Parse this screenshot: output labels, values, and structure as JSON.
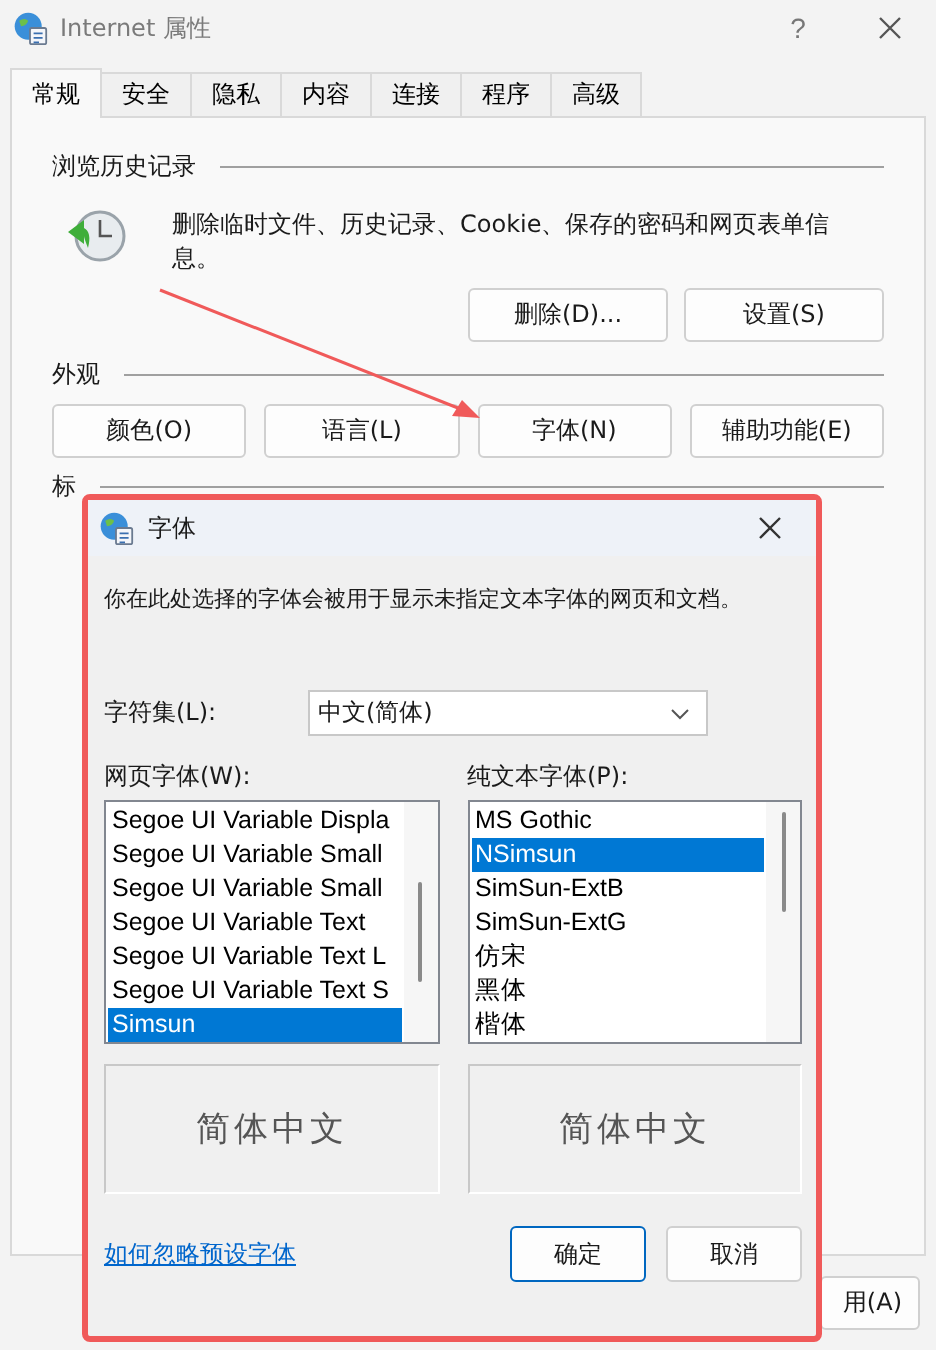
{
  "window": {
    "title": "Internet 属性",
    "help": "?"
  },
  "tabs": [
    {
      "label": "常规",
      "selected": true
    },
    {
      "label": "安全",
      "selected": false
    },
    {
      "label": "隐私",
      "selected": false
    },
    {
      "label": "内容",
      "selected": false
    },
    {
      "label": "连接",
      "selected": false
    },
    {
      "label": "程序",
      "selected": false
    },
    {
      "label": "高级",
      "selected": false
    }
  ],
  "browsing_history": {
    "heading": "浏览历史记录",
    "description": "删除临时文件、历史记录、Cookie、保存的密码和网页表单信息。",
    "buttons": [
      "删除(D)...",
      "设置(S)"
    ]
  },
  "appearance": {
    "heading": "外观",
    "buttons": [
      "颜色(O)",
      "语言(L)",
      "字体(N)",
      "辅助功能(E)"
    ]
  },
  "tabs_section": {
    "heading": "标"
  },
  "footer_buttons": [
    "用(A)"
  ],
  "font_dialog": {
    "title": "字体",
    "description": "你在此处选择的字体会被用于显示未指定文本字体的网页和文档。",
    "charset": {
      "label": "字符集(L):",
      "value": "中文(简体)"
    },
    "web_font": {
      "label": "网页字体(W):",
      "items": [
        {
          "label": "Segoe UI Variable Displa",
          "selected": false
        },
        {
          "label": "Segoe UI Variable Small",
          "selected": false
        },
        {
          "label": "Segoe UI Variable Small",
          "selected": false
        },
        {
          "label": "Segoe UI Variable Text",
          "selected": false
        },
        {
          "label": "Segoe UI Variable Text L",
          "selected": false
        },
        {
          "label": "Segoe UI Variable Text S",
          "selected": false
        },
        {
          "label": "Simsun",
          "selected": true
        }
      ],
      "preview": "简体中文"
    },
    "plain_font": {
      "label": "纯文本字体(P):",
      "items": [
        {
          "label": "MS Gothic",
          "selected": false
        },
        {
          "label": "NSimsun",
          "selected": true
        },
        {
          "label": "SimSun-ExtB",
          "selected": false
        },
        {
          "label": "SimSun-ExtG",
          "selected": false
        },
        {
          "label": "仿宋",
          "selected": false
        },
        {
          "label": "黑体",
          "selected": false
        },
        {
          "label": "楷体",
          "selected": false
        }
      ],
      "preview": "简体中文"
    },
    "link": "如何忽略预设字体",
    "buttons": [
      "确定",
      "取消"
    ]
  }
}
